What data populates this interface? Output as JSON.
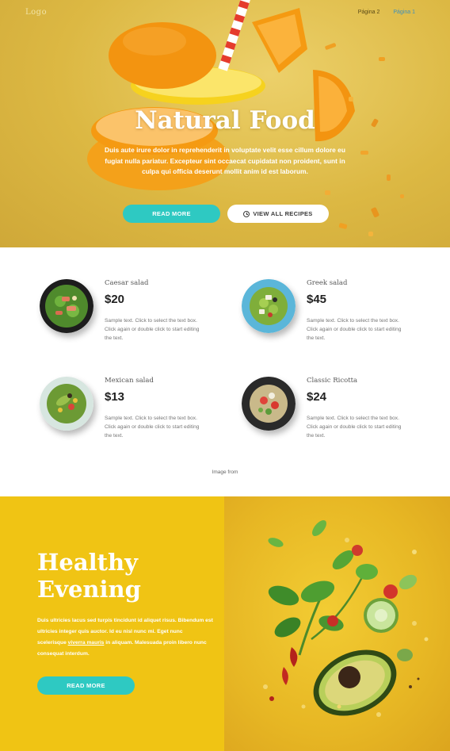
{
  "header": {
    "logo": "Logo",
    "nav": [
      {
        "label": "Página 2",
        "active": false
      },
      {
        "label": "Página 1",
        "active": true
      }
    ]
  },
  "hero": {
    "title": "Natural Food",
    "text": "Duis aute irure dolor in reprehenderit in voluptate velit esse cillum dolore eu fugiat nulla pariatur. Excepteur sint occaecat cupidatat non proident, sunt in culpa qui officia deserunt mollit anim id est laborum.",
    "read_more": "READ MORE",
    "view_all": "VIEW ALL RECIPES",
    "icon": "clock-icon"
  },
  "menu": {
    "items": [
      {
        "name": "Caesar salad",
        "price": "$20",
        "desc": "Sample text. Click to select the text box. Click again or double click to start editing the text.",
        "plate": "dark"
      },
      {
        "name": "Greek salad",
        "price": "$45",
        "desc": "Sample text. Click to select the text box. Click again or double click to start editing the text.",
        "plate": "blue"
      },
      {
        "name": "Mexican salad",
        "price": "$13",
        "desc": "Sample text. Click to select the text box. Click again or double click to start editing the text.",
        "plate": "light"
      },
      {
        "name": "Classic Ricotta",
        "price": "$24",
        "desc": "Sample text. Click to select the text box. Click again or double click to start editing the text.",
        "plate": "dark"
      }
    ],
    "image_from": "Image from"
  },
  "evening": {
    "title_line1": "Healthy",
    "title_line2": "Evening",
    "text_before": "Duis ultricies lacus sed turpis tincidunt id aliquet risus. Bibendum est ultricies integer quis auctor. Id eu nisl nunc mi. Eget nunc scelerisque ",
    "text_link": "viverra mauris",
    "text_after": " in aliquam. Malesuada proin libero nunc consequat interdum.",
    "read_more": "READ MORE"
  },
  "colors": {
    "accent_teal": "#2ec9c2",
    "hero_yellow": "#dcb843",
    "evening_yellow": "#f0c414"
  }
}
